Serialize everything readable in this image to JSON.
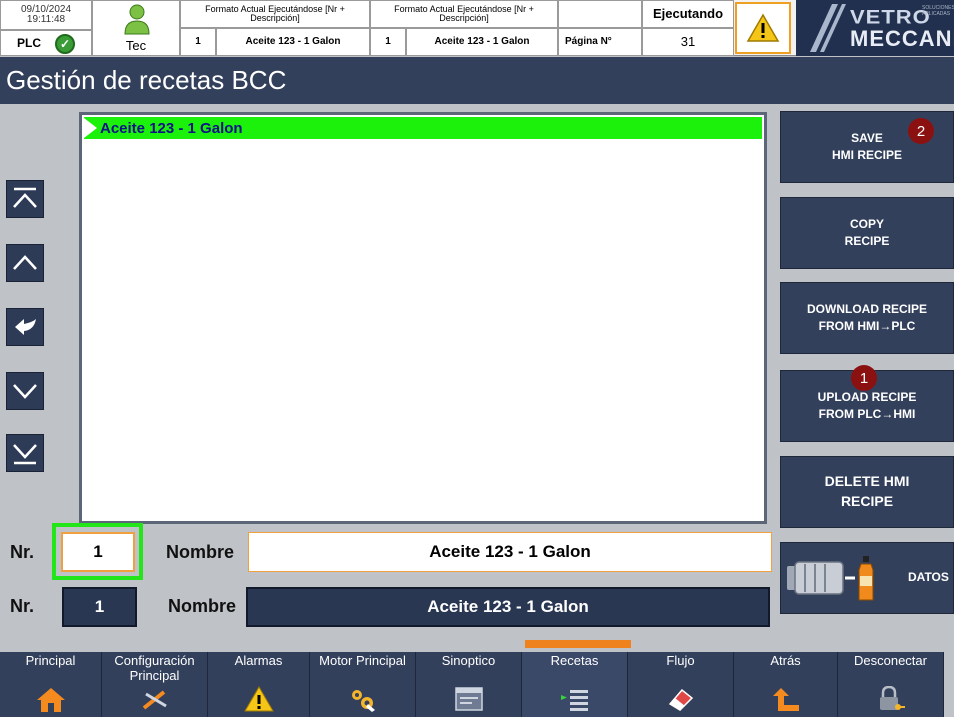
{
  "header": {
    "date": "09/10/2024",
    "time": "19:11:48",
    "plc_label": "PLC",
    "user": "Tec",
    "format_col1_title": "Formato Actual Ejecutándose [Nr + Descripción]",
    "format_col2_title": "Formato Actual Ejecutándose [Nr + Descripción]",
    "format1_nr": "1",
    "format1_desc": "Aceite 123 - 1 Galon",
    "format2_nr": "1",
    "format2_desc": "Aceite 123 - 1 Galon",
    "status": "Ejecutando",
    "page_label": "Página N°",
    "page_number": "31",
    "logo_top": "VETRO",
    "logo_tag": "SOLUCIONES APLICADAS",
    "logo_bottom": "MECCANICA"
  },
  "page_title": "Gestión de recetas BCC",
  "recipe_list": {
    "items": [
      "Aceite 123 - 1 Galon"
    ]
  },
  "actions": {
    "save": "SAVE\nHMI RECIPE",
    "copy": "COPY\nRECIPE",
    "download": "DOWNLOAD RECIPE\nFROM HMI→PLC",
    "upload": "UPLOAD RECIPE\nFROM PLC→HMI",
    "delete": "DELETE HMI\nRECIPE",
    "datos": "DATOS",
    "badge_save": "2",
    "badge_upload": "1"
  },
  "fields": {
    "nr_label": "Nr.",
    "name_label": "Nombre",
    "hmi_nr": "1",
    "hmi_name": "Aceite 123 - 1 Galon",
    "plc_nr": "1",
    "plc_name": "Aceite 123 - 1 Galon"
  },
  "menu": {
    "items": [
      {
        "label": "Principal",
        "icon": "home-icon"
      },
      {
        "label": "Configuración Principal",
        "icon": "tools-icon"
      },
      {
        "label": "Alarmas",
        "icon": "warning-icon"
      },
      {
        "label": "Motor Principal",
        "icon": "gears-icon"
      },
      {
        "label": "Sinoptico",
        "icon": "window-icon"
      },
      {
        "label": "Recetas",
        "icon": "list-icon"
      },
      {
        "label": "Flujo",
        "icon": "eraser-icon"
      },
      {
        "label": "Atrás",
        "icon": "back-arrow-icon"
      },
      {
        "label": "Desconectar",
        "icon": "lock-key-icon"
      }
    ],
    "active": "Recetas"
  },
  "colors": {
    "panel_dark": "#33405c",
    "selected_row": "#1cf10b",
    "accent_orange": "#f0821e",
    "highlight_green": "#22e61a",
    "badge_red": "#8b1111"
  }
}
